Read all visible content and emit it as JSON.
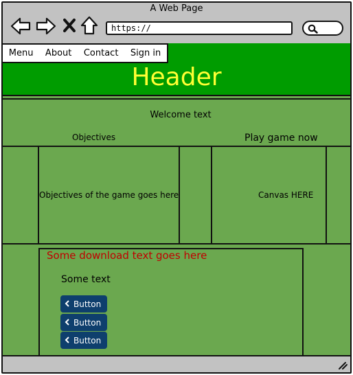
{
  "window": {
    "title": "A Web Page"
  },
  "browser": {
    "url": "https://",
    "icons": [
      "back-arrow-icon",
      "forward-arrow-icon",
      "close-x-icon",
      "home-icon",
      "search-icon",
      "resize-grip-icon"
    ]
  },
  "nav": {
    "items": [
      "Menu",
      "About",
      "Contact",
      "Sign in"
    ]
  },
  "header": {
    "title": "Header"
  },
  "main": {
    "welcome": "Welcome text",
    "objectives_heading": "Objectives",
    "play_heading": "Play game now",
    "objectives_body": "Objectives of the game goes here",
    "canvas_label": "Canvas HERE"
  },
  "download": {
    "title": "Some download text goes here",
    "subtitle": "Some text",
    "buttons": [
      "Button",
      "Button",
      "Button"
    ]
  },
  "colors": {
    "header_bg": "#009c00",
    "header_text": "#ffff33",
    "content_bg": "#6ba84f",
    "download_title": "#c00000",
    "button_bg": "#0e3f6d",
    "chrome": "#c2c2c2"
  }
}
